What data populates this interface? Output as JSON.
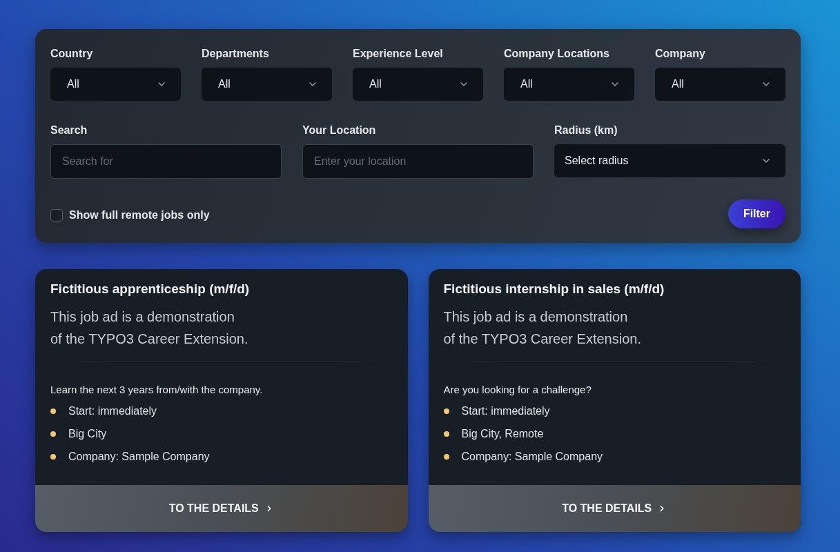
{
  "filters": {
    "selects": [
      {
        "label": "Country",
        "value": "All"
      },
      {
        "label": "Departments",
        "value": "All"
      },
      {
        "label": "Experience Level",
        "value": "All"
      },
      {
        "label": "Company Locations",
        "value": "All"
      },
      {
        "label": "Company",
        "value": "All"
      }
    ],
    "search": {
      "label": "Search",
      "placeholder": "Search for"
    },
    "location": {
      "label": "Your Location",
      "placeholder": "Enter your location"
    },
    "radius": {
      "label": "Radius (km)",
      "value": "Select radius"
    },
    "remote_only": {
      "label": "Show full remote jobs only",
      "checked": false
    },
    "filter_button": "Filter"
  },
  "jobs": [
    {
      "title": "Fictitious apprenticeship (m/f/d)",
      "description": "This job ad is a demonstration\nof the TYPO3 Career Extension.",
      "intro": "Learn the next 3 years from/with the company.",
      "facts": [
        "Start: immediately",
        "Big City",
        "Company: Sample Company"
      ],
      "link": "TO THE DETAILS"
    },
    {
      "title": "Fictitious internship in sales (m/f/d)",
      "description": "This job ad is a demonstration\nof the TYPO3 Career Extension.",
      "intro": "Are you looking for a challenge?",
      "facts": [
        "Start: immediately",
        "Big City, Remote",
        "Company: Sample Company"
      ],
      "link": "TO THE DETAILS"
    }
  ]
}
